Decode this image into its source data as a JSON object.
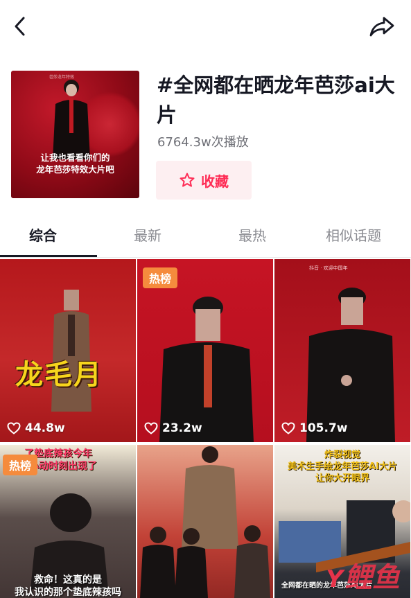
{
  "topbar": {
    "back_icon": "back-arrow-icon",
    "share_icon": "share-icon"
  },
  "topic": {
    "title": "#全网都在晒龙年芭莎ai大片",
    "plays": "6764.3w次播放",
    "collect_label": "收藏",
    "cover": {
      "text_line1": "让我也看看你们的",
      "text_line2": "龙年芭莎特效大片吧",
      "tiny_text": "芭莎龙年特效"
    }
  },
  "tabs": [
    {
      "label": "综合",
      "active": true
    },
    {
      "label": "最新",
      "active": false
    },
    {
      "label": "最热",
      "active": false
    },
    {
      "label": "相似话题",
      "active": false
    }
  ],
  "videos": [
    {
      "likes": "44.8w",
      "caption": "龙毛月",
      "badge": ""
    },
    {
      "likes": "23.2w",
      "caption": "",
      "badge": "热榜"
    },
    {
      "likes": "105.7w",
      "caption": "",
      "badge": "",
      "mark": "抖音 · 欢迎中国年"
    },
    {
      "likes": "",
      "badge": "热榜",
      "top_caption": "了垫底辣孩今年",
      "top_caption2": "的心动时刻出现了",
      "bottom_caption": "救命！这真的是",
      "bottom_caption2": "我认识的那个垫底辣孩吗"
    },
    {
      "likes": "",
      "badge": ""
    },
    {
      "likes": "",
      "badge": "",
      "top_caption": "炸裂视觉",
      "top_caption2": "美术生手绘龙年芭莎AI大片",
      "top_caption3": "让你大开眼界",
      "bottom_caption": "全网都在晒的龙年芭莎AI大片"
    }
  ],
  "watermark": {
    "part1": "Y",
    "part2": "鲤鱼"
  },
  "colors": {
    "accent": "#fe2c55",
    "hot_badge": "#f58b3d",
    "caption_yellow": "#f7d51d"
  }
}
